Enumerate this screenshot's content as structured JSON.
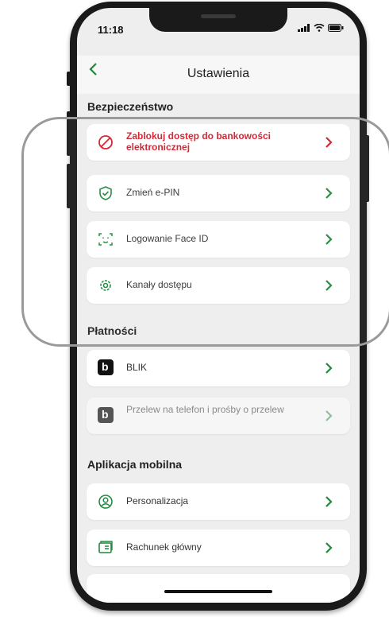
{
  "status": {
    "time": "11:18"
  },
  "header": {
    "title": "Ustawienia"
  },
  "sections": {
    "security": "Bezpieczeństwo",
    "payments": "Płatności",
    "app": "Aplikacja mobilna"
  },
  "security_items": [
    {
      "label": "Zablokuj dostęp do bankowości elektronicznej",
      "icon": "block-icon",
      "color": "#d51b2a"
    },
    {
      "label": "Zmień e-PIN",
      "icon": "shield-check-icon"
    },
    {
      "label": "Logowanie Face ID",
      "icon": "face-id-icon"
    },
    {
      "label": "Kanały dostępu",
      "icon": "gear-icon"
    }
  ],
  "payment_items": [
    {
      "label": "BLIK",
      "icon": "blik-icon"
    },
    {
      "label": "Przelew na telefon i prośby o przelew",
      "icon": "blik-icon"
    }
  ],
  "app_items": [
    {
      "label": "Personalizacja",
      "icon": "user-circle-icon"
    },
    {
      "label": "Rachunek główny",
      "icon": "account-card-icon"
    }
  ],
  "colors": {
    "accent": "#1f8a3d",
    "danger": "#d51b2a"
  }
}
